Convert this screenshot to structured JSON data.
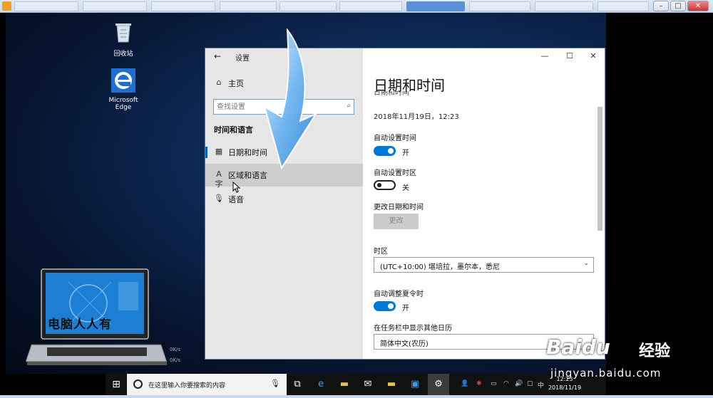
{
  "desktop": {
    "icons": [
      {
        "label": "回收站"
      },
      {
        "label": "Microsoft Edge"
      }
    ],
    "logo_text": "电脑人人有",
    "net_speed": [
      "0K/s",
      "0K/s"
    ]
  },
  "settings": {
    "app_title": "设置",
    "nav": {
      "home": "主页",
      "search_placeholder": "查找设置",
      "section": "时间和语言",
      "items": [
        {
          "label": "日期和时间",
          "icon": "calendar-clock-icon",
          "selected": true
        },
        {
          "label": "区域和语言",
          "icon": "language-icon",
          "hover": true
        },
        {
          "label": "语音",
          "icon": "microphone-icon"
        }
      ]
    },
    "content": {
      "page_title": "日期和时间",
      "clipped_heading": "日期和时间",
      "current_datetime": "2018年11月19日，12:23",
      "auto_time_label": "自动设置时间",
      "auto_time_state": "开",
      "auto_tz_label": "自动设置时区",
      "auto_tz_state": "关",
      "change_label": "更改日期和时间",
      "change_button": "更改",
      "tz_label": "时区",
      "tz_value": "(UTC+10:00) 堪培拉，墨尔本，悉尼",
      "dst_label": "自动调整夏令时",
      "dst_state": "开",
      "calendar_label": "在任务栏中显示其他日历",
      "calendar_value": "简体中文(农历)"
    }
  },
  "taskbar": {
    "search_placeholder": "在这里输入你要搜索的内容",
    "clock_time": "12:23",
    "clock_date": "2018/11/19",
    "lang": "中"
  },
  "watermark": {
    "brand": "Baidu",
    "cn": "经验",
    "url": "jingyan.baidu.com"
  },
  "colors": {
    "accent": "#0078d7",
    "nav_bg": "#e6e6e6"
  }
}
